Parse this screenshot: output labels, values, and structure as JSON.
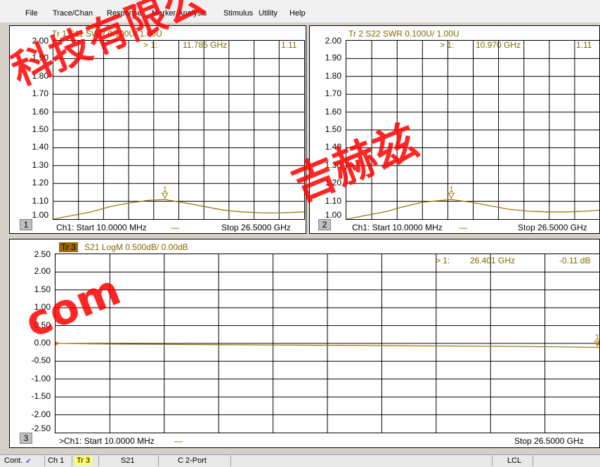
{
  "menu": [
    "File",
    "Trace/Chan",
    "Response",
    "Marker/Analysis",
    "Stimulus",
    "Utility",
    "Help"
  ],
  "colors": {
    "trace": "#9a7a10",
    "grid": "#000000",
    "text": "#806600",
    "watermark": "#ff0000"
  },
  "panels": [
    {
      "id": "tr1",
      "header": "Tr 1  S11 SWR 0.100U/ 1.00U",
      "marker": {
        "index": "> 1:",
        "freq": "11.785 GHz",
        "value": "1.11"
      },
      "channel_number": "1",
      "footer_start": "Ch1:  Start  10.0000 MHz",
      "footer_stop": "Stop  26.5000 GHz",
      "yticks": [
        "2.00",
        "1.90",
        "1.80",
        "1.70",
        "1.60",
        "1.50",
        "1.40",
        "1.30",
        "1.20",
        "1.10",
        "1.00"
      ]
    },
    {
      "id": "tr2",
      "header": "Tr 2  S22 SWR 0.100U/ 1.00U",
      "marker": {
        "index": "> 1:",
        "freq": "10.970 GHz",
        "value": "1.11"
      },
      "channel_number": "2",
      "footer_start": "Ch1:  Start  10.0000 MHz",
      "footer_stop": "Stop  26.5000 GHz",
      "yticks": [
        "2.00",
        "1.90",
        "1.80",
        "1.70",
        "1.60",
        "1.50",
        "1.40",
        "1.30",
        "1.20",
        "1.10",
        "1.00"
      ]
    },
    {
      "id": "tr3",
      "header_badge": "Tr 3",
      "header": "S21 LogM 0.500dB/ 0.00dB",
      "marker": {
        "index": "> 1:",
        "freq": "26.401 GHz",
        "value": "-0.11 dB"
      },
      "channel_number": "3",
      "footer_start": ">Ch1:  Start  10.0000 MHz",
      "footer_stop": "Stop  26.5000 GHz",
      "yticks": [
        "2.50",
        "2.00",
        "1.50",
        "1.00",
        "0.50",
        "0.00",
        "-0.50",
        "-1.00",
        "-1.50",
        "-2.00",
        "-2.50"
      ]
    }
  ],
  "marker_label": "1",
  "status": {
    "cont": "Cont.",
    "ch": "Ch 1",
    "tr": "Tr 3",
    "param": "S21",
    "cal": "C  2-Port",
    "lcl": "LCL"
  },
  "watermark": [
    "科技有限公",
    "吉赫兹",
    "com"
  ],
  "chart_data": [
    {
      "type": "line",
      "title": "Tr 1  S11 SWR 0.100U/ 1.00U",
      "xlabel": "",
      "ylabel": "",
      "x_unit": "GHz",
      "xlim": [
        0.01,
        26.5
      ],
      "ylim": [
        1.0,
        2.0
      ],
      "series": [
        {
          "name": "S11",
          "x": [
            0.01,
            2,
            4,
            6,
            8,
            10,
            11.785,
            14,
            16,
            18,
            20,
            22,
            24,
            26.5
          ],
          "y": [
            1.0,
            1.02,
            1.04,
            1.07,
            1.09,
            1.105,
            1.11,
            1.09,
            1.07,
            1.05,
            1.04,
            1.035,
            1.035,
            1.04
          ]
        }
      ],
      "markers": [
        {
          "x": 11.785,
          "y": 1.11
        }
      ]
    },
    {
      "type": "line",
      "title": "Tr 2  S22 SWR 0.100U/ 1.00U",
      "xlabel": "",
      "ylabel": "",
      "x_unit": "GHz",
      "xlim": [
        0.01,
        26.5
      ],
      "ylim": [
        1.0,
        2.0
      ],
      "series": [
        {
          "name": "S22",
          "x": [
            0.01,
            2,
            4,
            6,
            8,
            10.97,
            13,
            15,
            17,
            19,
            21,
            23,
            25,
            26.5
          ],
          "y": [
            1.0,
            1.02,
            1.04,
            1.07,
            1.095,
            1.11,
            1.095,
            1.075,
            1.055,
            1.045,
            1.04,
            1.04,
            1.045,
            1.05
          ]
        }
      ],
      "markers": [
        {
          "x": 10.97,
          "y": 1.11
        }
      ]
    },
    {
      "type": "line",
      "title": "S21 LogM 0.500dB/ 0.00dB",
      "xlabel": "",
      "ylabel": "",
      "x_unit": "GHz",
      "xlim": [
        0.01,
        26.5
      ],
      "ylim": [
        -2.5,
        2.5
      ],
      "series": [
        {
          "name": "S21",
          "x": [
            0.01,
            3,
            6,
            9,
            12,
            15,
            18,
            21,
            24,
            26.401,
            26.5
          ],
          "y": [
            0.0,
            -0.02,
            -0.03,
            -0.04,
            -0.05,
            -0.06,
            -0.07,
            -0.08,
            -0.09,
            -0.11,
            -0.11
          ]
        }
      ],
      "markers": [
        {
          "x": 26.401,
          "y": -0.11
        }
      ]
    }
  ]
}
